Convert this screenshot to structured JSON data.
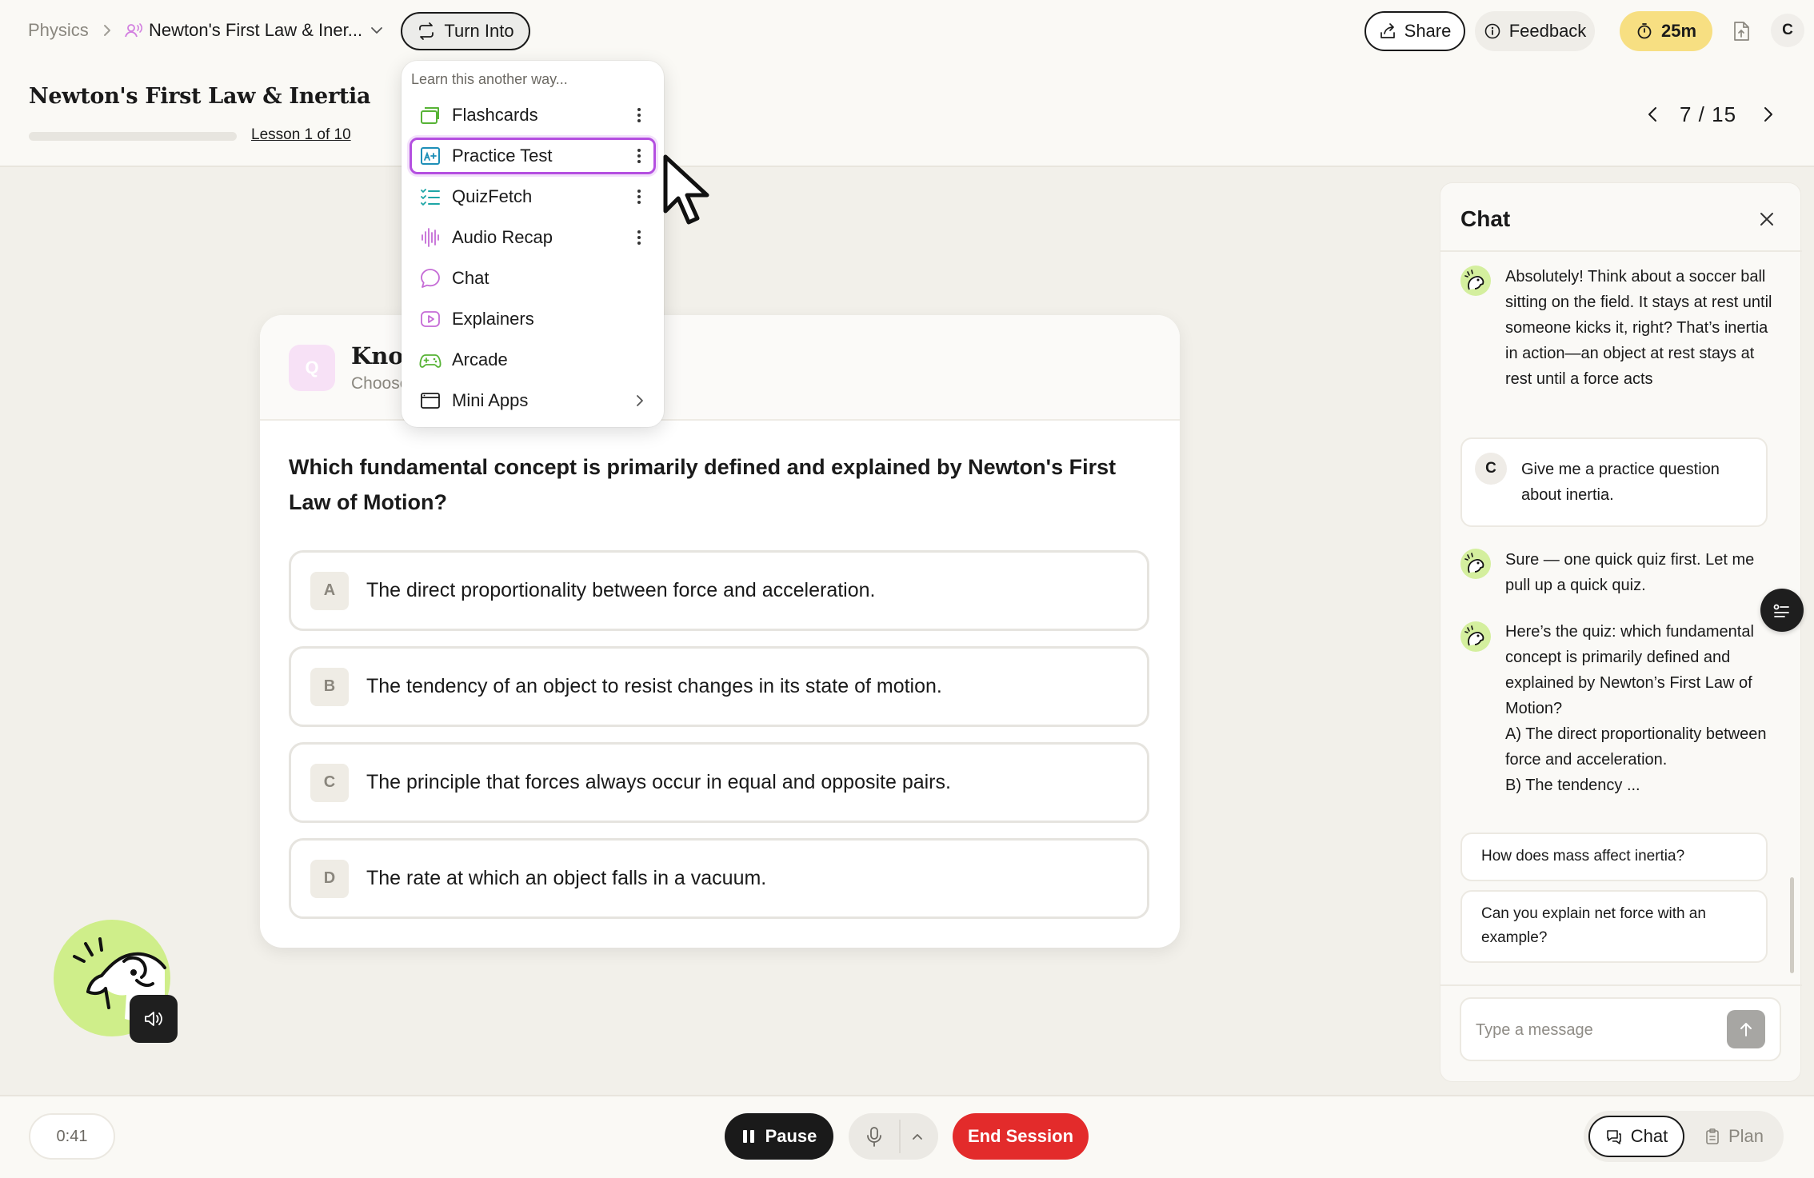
{
  "header": {
    "breadcrumb_root": "Physics",
    "breadcrumb_title": "Newton's First Law & Iner...",
    "turn_into_label": "Turn Into",
    "share_label": "Share",
    "feedback_label": "Feedback",
    "timer_label": "25m",
    "user_initial": "C",
    "page_title": "Newton's First Law & Inertia",
    "lesson_label": "Lesson 1 of 10",
    "lesson_progress": 0.0,
    "pager": "7 / 15"
  },
  "turn_into_menu": {
    "heading": "Learn this another way...",
    "items": [
      {
        "label": "Flashcards",
        "icon": "flashcards-icon",
        "color": "#57b336"
      },
      {
        "label": "Practice Test",
        "icon": "practice-test-icon",
        "color": "#1e8fb8",
        "selected": true
      },
      {
        "label": "QuizFetch",
        "icon": "quizfetch-icon",
        "color": "#1ea6a6"
      },
      {
        "label": "Audio Recap",
        "icon": "audio-wave-icon",
        "color": "#c56bd6"
      },
      {
        "label": "Chat",
        "icon": "chat-bubble-icon",
        "color": "#c56bd6"
      },
      {
        "label": "Explainers",
        "icon": "video-play-icon",
        "color": "#c56bd6"
      },
      {
        "label": "Arcade",
        "icon": "gamepad-icon",
        "color": "#57b336"
      },
      {
        "label": "Mini Apps",
        "icon": "window-icon",
        "color": "#1a1a1a"
      }
    ]
  },
  "quiz": {
    "badge": "Q",
    "title": "Knowledge Check",
    "subtitle": "Choose the best answer",
    "question": "Which fundamental concept is primarily defined and explained by Newton's First Law of Motion?",
    "options": [
      {
        "letter": "A",
        "text": "The direct proportionality between force and acceleration."
      },
      {
        "letter": "B",
        "text": "The tendency of an object to resist changes in its state of motion."
      },
      {
        "letter": "C",
        "text": "The principle that forces always occur in equal and opposite pairs."
      },
      {
        "letter": "D",
        "text": "The rate at which an object falls in a vacuum."
      }
    ]
  },
  "chat": {
    "title": "Chat",
    "messages": [
      {
        "role": "bot",
        "text": "Absolutely! Think about a soccer ball sitting on the field. It stays at rest until someone kicks it, right? That’s inertia in action—an object at rest stays at rest until a force acts"
      },
      {
        "role": "user",
        "initial": "C",
        "text": "Give me a practice question about inertia."
      },
      {
        "role": "bot",
        "text": "Sure — one quick quiz first. Let me pull up a quick quiz."
      },
      {
        "role": "bot",
        "text": "Here’s the quiz: which fundamental concept is primarily defined and explained by Newton’s First Law of Motion?\nA) The direct proportionality between force and acceleration.\nB) The tendency ..."
      }
    ],
    "suggestions": [
      "How does mass affect inertia?",
      "Can you explain net force with an example?"
    ],
    "input_placeholder": "Type a message"
  },
  "bottom": {
    "elapsed": "0:41",
    "pause_label": "Pause",
    "end_label": "End Session",
    "chat_tab": "Chat",
    "plan_tab": "Plan"
  },
  "colors": {
    "accent_yellow": "#f7df82",
    "danger": "#e32b2b",
    "selection_purple": "#b44fe0",
    "mascot_green": "#cfee8a"
  }
}
